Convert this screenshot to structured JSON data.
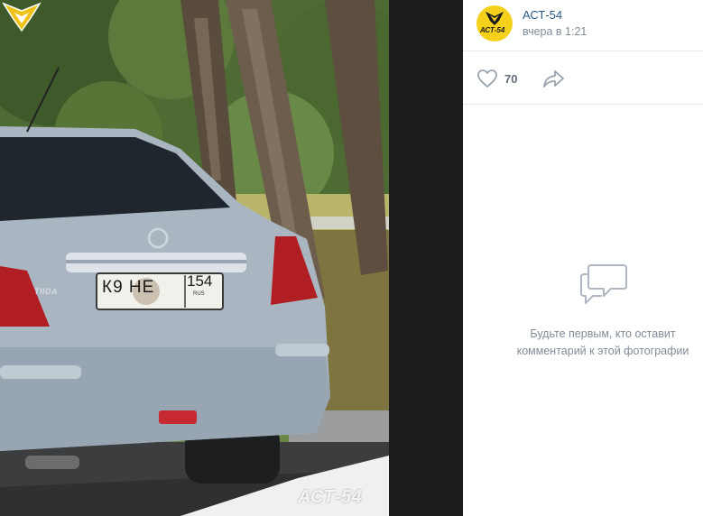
{
  "photo": {
    "plate_number": "К9  НЕ",
    "plate_region": "154",
    "plate_country": "RUS",
    "car_badge": "TIIDA",
    "watermark": "АСТ-54"
  },
  "post": {
    "author": "АСТ-54",
    "avatar_label": "АСТ-54",
    "time": "вчера в 1:21"
  },
  "actions": {
    "like_icon": "heart-icon",
    "likes": "70",
    "share_icon": "share-arrow-icon"
  },
  "comments": {
    "icon": "comment-bubbles-icon",
    "empty_line1": "Будьте первым, кто оставит",
    "empty_line2": "комментарий к этой фотографии"
  },
  "colors": {
    "link": "#2a5885",
    "muted": "#818c99",
    "avatar_bg": "#f6d11b",
    "car_body": "#a9b6c2"
  }
}
